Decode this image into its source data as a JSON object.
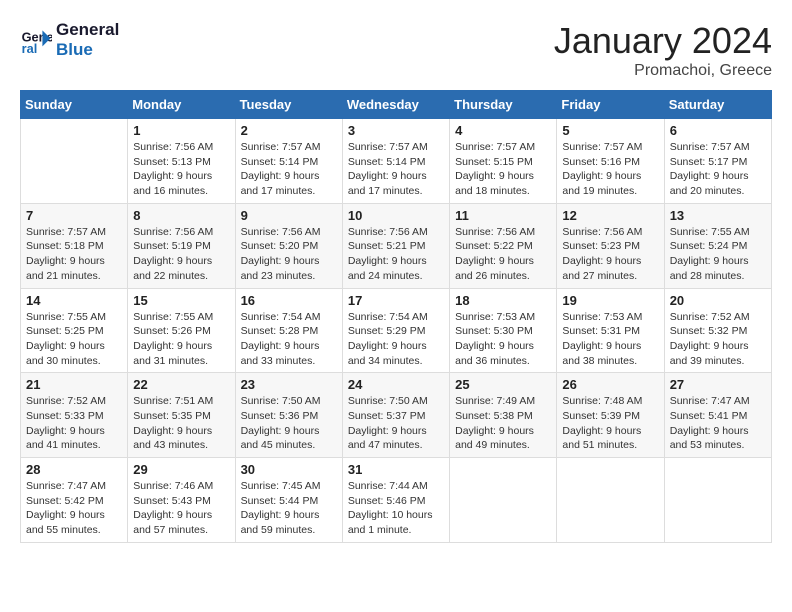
{
  "header": {
    "logo_line1": "General",
    "logo_line2": "Blue",
    "month_title": "January 2024",
    "location": "Promachoi, Greece"
  },
  "weekdays": [
    "Sunday",
    "Monday",
    "Tuesday",
    "Wednesday",
    "Thursday",
    "Friday",
    "Saturday"
  ],
  "weeks": [
    [
      {
        "day": "",
        "info": ""
      },
      {
        "day": "1",
        "info": "Sunrise: 7:56 AM\nSunset: 5:13 PM\nDaylight: 9 hours\nand 16 minutes."
      },
      {
        "day": "2",
        "info": "Sunrise: 7:57 AM\nSunset: 5:14 PM\nDaylight: 9 hours\nand 17 minutes."
      },
      {
        "day": "3",
        "info": "Sunrise: 7:57 AM\nSunset: 5:14 PM\nDaylight: 9 hours\nand 17 minutes."
      },
      {
        "day": "4",
        "info": "Sunrise: 7:57 AM\nSunset: 5:15 PM\nDaylight: 9 hours\nand 18 minutes."
      },
      {
        "day": "5",
        "info": "Sunrise: 7:57 AM\nSunset: 5:16 PM\nDaylight: 9 hours\nand 19 minutes."
      },
      {
        "day": "6",
        "info": "Sunrise: 7:57 AM\nSunset: 5:17 PM\nDaylight: 9 hours\nand 20 minutes."
      }
    ],
    [
      {
        "day": "7",
        "info": "Sunrise: 7:57 AM\nSunset: 5:18 PM\nDaylight: 9 hours\nand 21 minutes."
      },
      {
        "day": "8",
        "info": "Sunrise: 7:56 AM\nSunset: 5:19 PM\nDaylight: 9 hours\nand 22 minutes."
      },
      {
        "day": "9",
        "info": "Sunrise: 7:56 AM\nSunset: 5:20 PM\nDaylight: 9 hours\nand 23 minutes."
      },
      {
        "day": "10",
        "info": "Sunrise: 7:56 AM\nSunset: 5:21 PM\nDaylight: 9 hours\nand 24 minutes."
      },
      {
        "day": "11",
        "info": "Sunrise: 7:56 AM\nSunset: 5:22 PM\nDaylight: 9 hours\nand 26 minutes."
      },
      {
        "day": "12",
        "info": "Sunrise: 7:56 AM\nSunset: 5:23 PM\nDaylight: 9 hours\nand 27 minutes."
      },
      {
        "day": "13",
        "info": "Sunrise: 7:55 AM\nSunset: 5:24 PM\nDaylight: 9 hours\nand 28 minutes."
      }
    ],
    [
      {
        "day": "14",
        "info": "Sunrise: 7:55 AM\nSunset: 5:25 PM\nDaylight: 9 hours\nand 30 minutes."
      },
      {
        "day": "15",
        "info": "Sunrise: 7:55 AM\nSunset: 5:26 PM\nDaylight: 9 hours\nand 31 minutes."
      },
      {
        "day": "16",
        "info": "Sunrise: 7:54 AM\nSunset: 5:28 PM\nDaylight: 9 hours\nand 33 minutes."
      },
      {
        "day": "17",
        "info": "Sunrise: 7:54 AM\nSunset: 5:29 PM\nDaylight: 9 hours\nand 34 minutes."
      },
      {
        "day": "18",
        "info": "Sunrise: 7:53 AM\nSunset: 5:30 PM\nDaylight: 9 hours\nand 36 minutes."
      },
      {
        "day": "19",
        "info": "Sunrise: 7:53 AM\nSunset: 5:31 PM\nDaylight: 9 hours\nand 38 minutes."
      },
      {
        "day": "20",
        "info": "Sunrise: 7:52 AM\nSunset: 5:32 PM\nDaylight: 9 hours\nand 39 minutes."
      }
    ],
    [
      {
        "day": "21",
        "info": "Sunrise: 7:52 AM\nSunset: 5:33 PM\nDaylight: 9 hours\nand 41 minutes."
      },
      {
        "day": "22",
        "info": "Sunrise: 7:51 AM\nSunset: 5:35 PM\nDaylight: 9 hours\nand 43 minutes."
      },
      {
        "day": "23",
        "info": "Sunrise: 7:50 AM\nSunset: 5:36 PM\nDaylight: 9 hours\nand 45 minutes."
      },
      {
        "day": "24",
        "info": "Sunrise: 7:50 AM\nSunset: 5:37 PM\nDaylight: 9 hours\nand 47 minutes."
      },
      {
        "day": "25",
        "info": "Sunrise: 7:49 AM\nSunset: 5:38 PM\nDaylight: 9 hours\nand 49 minutes."
      },
      {
        "day": "26",
        "info": "Sunrise: 7:48 AM\nSunset: 5:39 PM\nDaylight: 9 hours\nand 51 minutes."
      },
      {
        "day": "27",
        "info": "Sunrise: 7:47 AM\nSunset: 5:41 PM\nDaylight: 9 hours\nand 53 minutes."
      }
    ],
    [
      {
        "day": "28",
        "info": "Sunrise: 7:47 AM\nSunset: 5:42 PM\nDaylight: 9 hours\nand 55 minutes."
      },
      {
        "day": "29",
        "info": "Sunrise: 7:46 AM\nSunset: 5:43 PM\nDaylight: 9 hours\nand 57 minutes."
      },
      {
        "day": "30",
        "info": "Sunrise: 7:45 AM\nSunset: 5:44 PM\nDaylight: 9 hours\nand 59 minutes."
      },
      {
        "day": "31",
        "info": "Sunrise: 7:44 AM\nSunset: 5:46 PM\nDaylight: 10 hours\nand 1 minute."
      },
      {
        "day": "",
        "info": ""
      },
      {
        "day": "",
        "info": ""
      },
      {
        "day": "",
        "info": ""
      }
    ]
  ]
}
